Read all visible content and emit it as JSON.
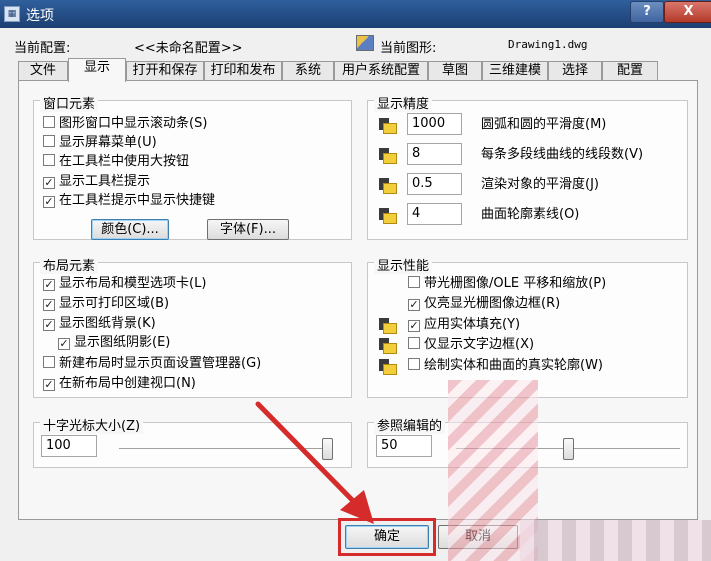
{
  "window": {
    "title": "选项",
    "icon": "options-app-icon",
    "help_label": "?",
    "close_label": "X"
  },
  "profile": {
    "current_config_label": "当前配置:",
    "current_config_value": "<<未命名配置>>",
    "current_drawing_label": "当前图形:",
    "current_drawing_value": "Drawing1.dwg"
  },
  "tabs": [
    {
      "label": "文件",
      "active": false
    },
    {
      "label": "显示",
      "active": true
    },
    {
      "label": "打开和保存",
      "active": false
    },
    {
      "label": "打印和发布",
      "active": false
    },
    {
      "label": "系统",
      "active": false
    },
    {
      "label": "用户系统配置",
      "active": false
    },
    {
      "label": "草图",
      "active": false
    },
    {
      "label": "三维建模",
      "active": false
    },
    {
      "label": "选择",
      "active": false
    },
    {
      "label": "配置",
      "active": false
    }
  ],
  "window_elements": {
    "title": "窗口元素",
    "checkboxes": [
      {
        "label": "图形窗口中显示滚动条(S)",
        "checked": false
      },
      {
        "label": "显示屏幕菜单(U)",
        "checked": false
      },
      {
        "label": "在工具栏中使用大按钮",
        "checked": false
      },
      {
        "label": "显示工具栏提示",
        "checked": true
      },
      {
        "label": "在工具栏提示中显示快捷键",
        "checked": true
      }
    ],
    "colors_button": "颜色(C)...",
    "fonts_button": "字体(F)..."
  },
  "display_resolution": {
    "title": "显示精度",
    "rows": [
      {
        "value": "1000",
        "label": "圆弧和圆的平滑度(M)"
      },
      {
        "value": "8",
        "label": "每条多段线曲线的线段数(V)"
      },
      {
        "value": "0.5",
        "label": "渲染对象的平滑度(J)"
      },
      {
        "value": "4",
        "label": "曲面轮廓素线(O)"
      }
    ]
  },
  "layout_elements": {
    "title": "布局元素",
    "checkboxes": [
      {
        "label": "显示布局和模型选项卡(L)",
        "checked": true
      },
      {
        "label": "显示可打印区域(B)",
        "checked": true
      },
      {
        "label": "显示图纸背景(K)",
        "checked": true
      },
      {
        "label": "显示图纸阴影(E)",
        "checked": true
      },
      {
        "label": "新建布局时显示页面设置管理器(G)",
        "checked": false
      },
      {
        "label": "在新布局中创建视口(N)",
        "checked": true
      }
    ]
  },
  "display_performance": {
    "title": "显示性能",
    "checkboxes": [
      {
        "label": "带光栅图像/OLE 平移和缩放(P)",
        "checked": false,
        "icon": false
      },
      {
        "label": "仅亮显光栅图像边框(R)",
        "checked": true,
        "icon": false
      },
      {
        "label": "应用实体填充(Y)",
        "checked": true,
        "icon": true
      },
      {
        "label": "仅显示文字边框(X)",
        "checked": false,
        "icon": true
      },
      {
        "label": "绘制实体和曲面的真实轮廓(W)",
        "checked": false,
        "icon": true
      }
    ]
  },
  "crosshair": {
    "title": "十字光标大小(Z)",
    "value": "100",
    "level_percent": 100
  },
  "xref_fade": {
    "title": "参照编辑的",
    "value": "50",
    "level_percent": 50
  },
  "footer": {
    "ok_label": "确定",
    "cancel_label": "取消"
  },
  "colors": {
    "highlight": "#d62b2b",
    "titlebar": "#2f5f9c"
  }
}
